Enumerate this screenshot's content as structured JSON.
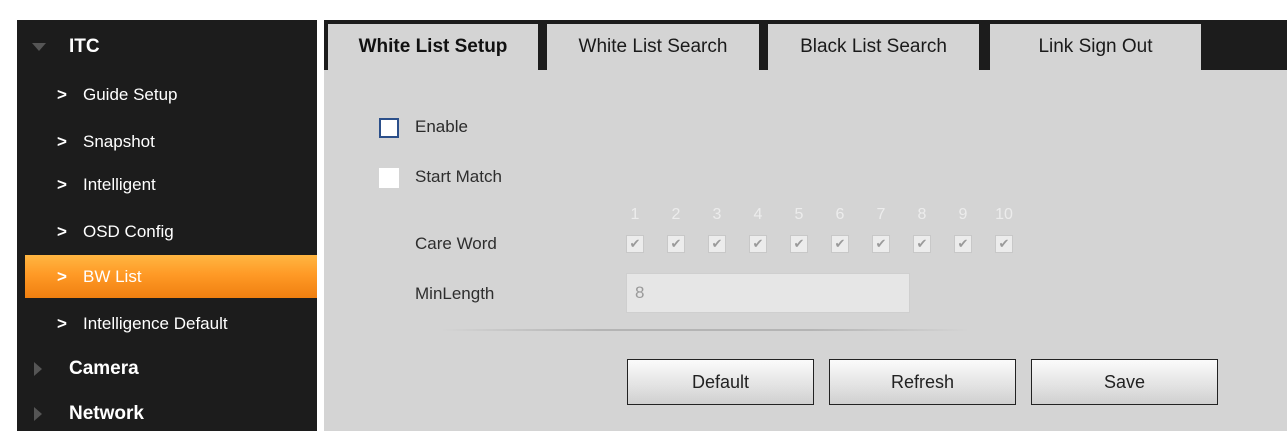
{
  "sidebar": {
    "groups": [
      {
        "label": "ITC",
        "expanded": true,
        "icon": "triangle-down-icon"
      },
      {
        "label": "Camera",
        "expanded": false,
        "icon": "triangle-right-icon"
      },
      {
        "label": "Network",
        "expanded": false,
        "icon": "triangle-right-icon"
      }
    ],
    "items": [
      {
        "label": "Guide Setup",
        "icon": "chevron-right-icon"
      },
      {
        "label": "Snapshot",
        "icon": "chevron-right-icon"
      },
      {
        "label": "Intelligent",
        "icon": "chevron-right-icon"
      },
      {
        "label": "OSD Config",
        "icon": "chevron-right-icon"
      },
      {
        "label": "BW List",
        "icon": "chevron-right-icon",
        "active": true
      },
      {
        "label": "Intelligence Default",
        "icon": "chevron-right-icon"
      }
    ],
    "chevron": ">"
  },
  "tabs": [
    {
      "label": "White List Setup",
      "active": true
    },
    {
      "label": "White List Search",
      "active": false
    },
    {
      "label": "Black List Search",
      "active": false
    },
    {
      "label": "Link Sign Out",
      "active": false
    }
  ],
  "form": {
    "enable": {
      "label": "Enable",
      "checked": false
    },
    "start_match": {
      "label": "Start Match",
      "checked": false,
      "disabled": true
    },
    "care_word": {
      "label": "Care Word",
      "numbers": [
        "1",
        "2",
        "3",
        "4",
        "5",
        "6",
        "7",
        "8",
        "9",
        "10"
      ],
      "checked": [
        true,
        true,
        true,
        true,
        true,
        true,
        true,
        true,
        true,
        true
      ],
      "check_glyph": "✔"
    },
    "min_length": {
      "label": "MinLength",
      "value": "8"
    }
  },
  "buttons": {
    "default": "Default",
    "refresh": "Refresh",
    "save": "Save"
  },
  "colors": {
    "sidebar_bg": "#1c1c1c",
    "active_item": "#ff9a26",
    "content_bg": "#d4d4d4"
  }
}
